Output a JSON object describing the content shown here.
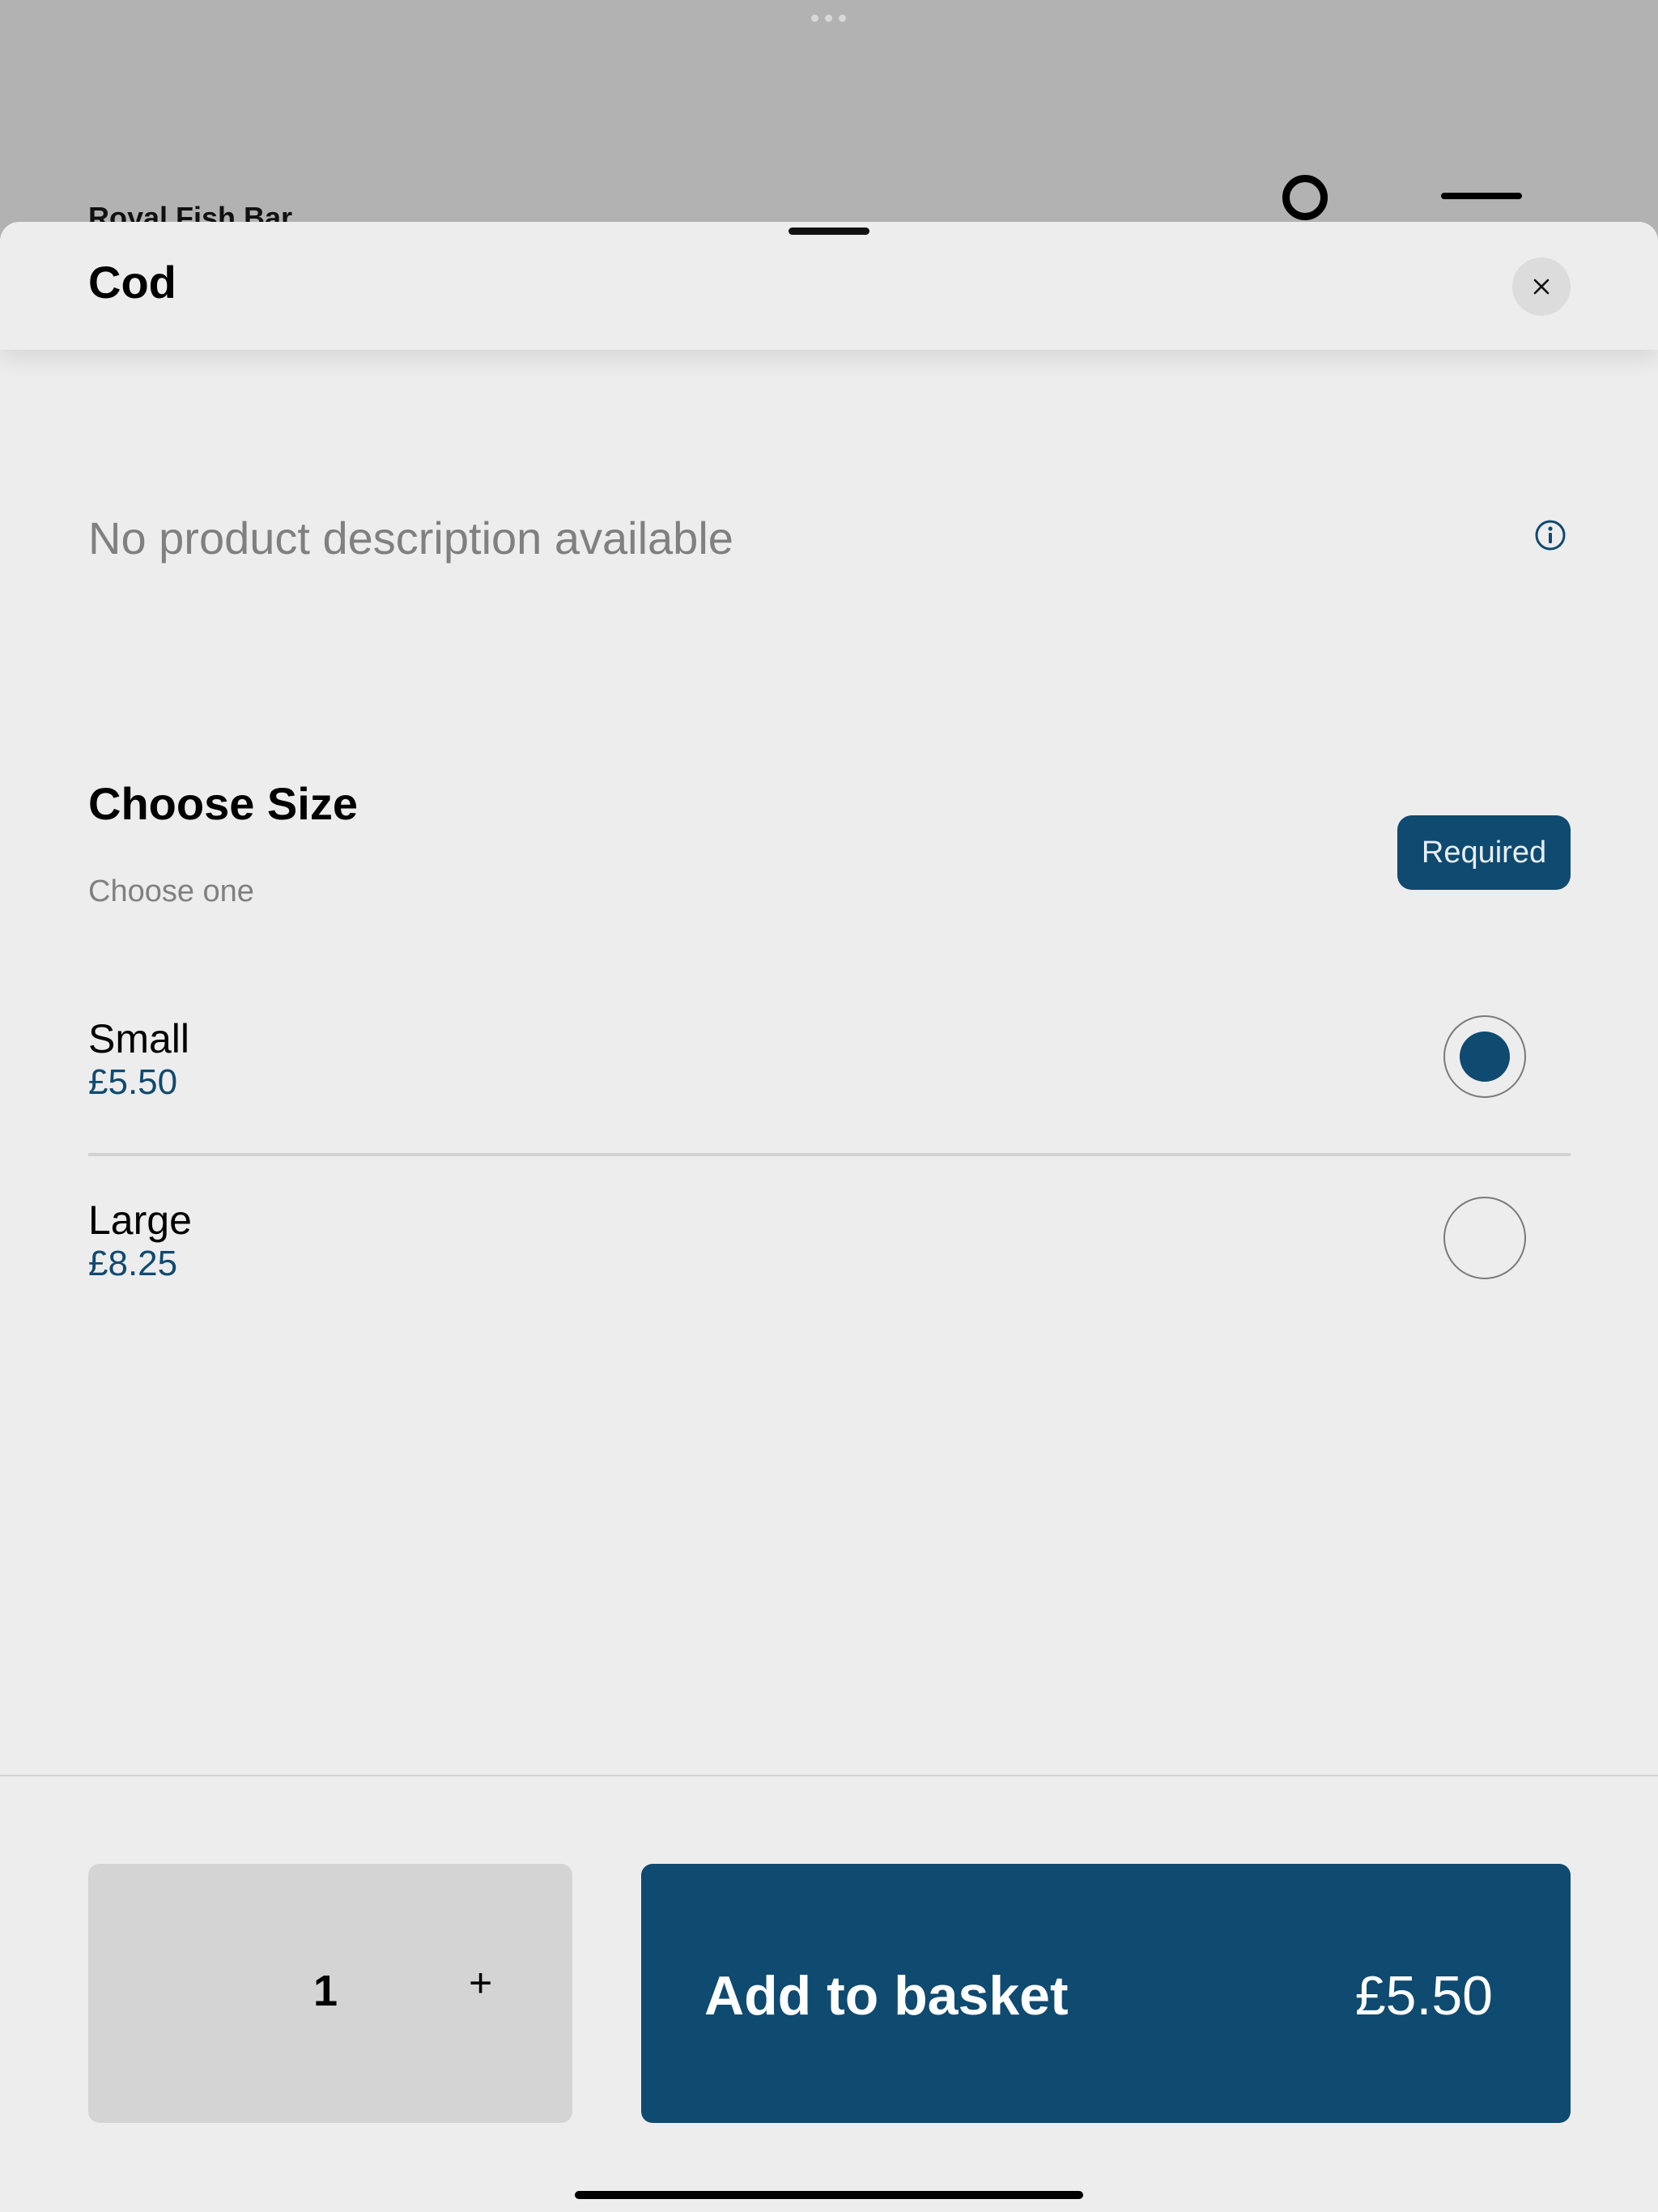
{
  "background": {
    "store_name": "Royal Fish Bar"
  },
  "sheet": {
    "title": "Cod",
    "description": "No product description available"
  },
  "modifier_group": {
    "title": "Choose Size",
    "subtitle": "Choose one",
    "badge": "Required",
    "options": [
      {
        "name": "Small",
        "price": "£5.50",
        "selected": true
      },
      {
        "name": "Large",
        "price": "£8.25",
        "selected": false
      }
    ]
  },
  "footer": {
    "quantity": "1",
    "plus_label": "+",
    "add_label": "Add to basket",
    "add_price": "£5.50"
  },
  "colors": {
    "accent": "#0f4a70",
    "sheet_bg": "#ededed",
    "dimmed_bg": "#b2b2b2"
  },
  "icons": [
    "more-dots-icon",
    "search-icon",
    "menu-icon",
    "close-icon",
    "info-icon"
  ]
}
